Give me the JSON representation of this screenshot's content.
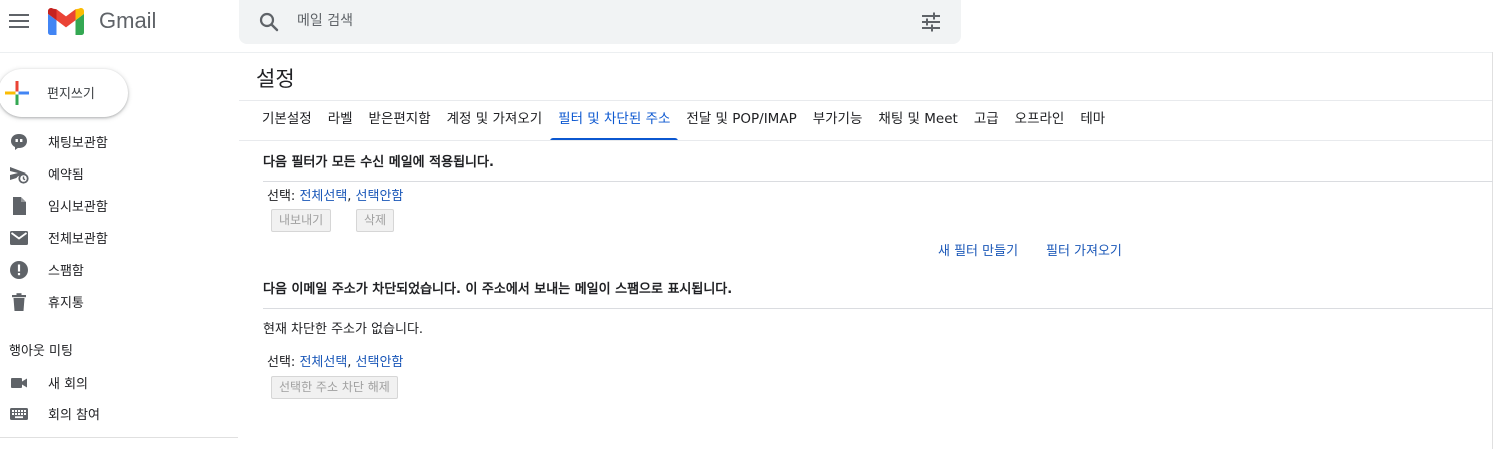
{
  "app": {
    "brand": "Gmail",
    "colors": {
      "accent": "#0b57d0",
      "link": "#1a57b8"
    }
  },
  "search": {
    "placeholder": "메일 검색",
    "value": ""
  },
  "sidebar": {
    "compose_label": "편지쓰기",
    "items": [
      {
        "label": "채팅보관함",
        "icon": "chat-archive-icon"
      },
      {
        "label": "예약됨",
        "icon": "scheduled-send-icon"
      },
      {
        "label": "임시보관함",
        "icon": "draft-icon"
      },
      {
        "label": "전체보관함",
        "icon": "mail-icon"
      },
      {
        "label": "스팸함",
        "icon": "report-icon"
      },
      {
        "label": "휴지통",
        "icon": "trash-icon"
      }
    ],
    "section_title": "행아웃 미팅",
    "meet_items": [
      {
        "label": "새 회의",
        "icon": "video-camera-icon"
      },
      {
        "label": "회의 참여",
        "icon": "keyboard-icon"
      }
    ]
  },
  "settings": {
    "title": "설정",
    "tabs": [
      "기본설정",
      "라벨",
      "받은편지함",
      "계정 및 가져오기",
      "필터 및 차단된 주소",
      "전달 및 POP/IMAP",
      "부가기능",
      "채팅 및 Meet",
      "고급",
      "오프라인",
      "테마"
    ],
    "active_tab": "필터 및 차단된 주소",
    "filters": {
      "heading": "다음 필터가 모든 수신 메일에 적용됩니다.",
      "select_label": "선택: ",
      "select_all": "전체선택",
      "select_separator": ", ",
      "select_none": "선택안함",
      "export_button": "내보내기",
      "delete_button": "삭제",
      "create_filter_link": "새 필터 만들기",
      "import_filter_link": "필터 가져오기"
    },
    "blocked": {
      "heading": "다음 이메일 주소가 차단되었습니다. 이 주소에서 보내는 메일이 스팸으로 표시됩니다.",
      "empty_message": "현재 차단한 주소가 없습니다.",
      "select_label": "선택: ",
      "select_all": "전체선택",
      "select_separator": ", ",
      "select_none": "선택안함",
      "unblock_button": "선택한 주소 차단 해제"
    }
  }
}
